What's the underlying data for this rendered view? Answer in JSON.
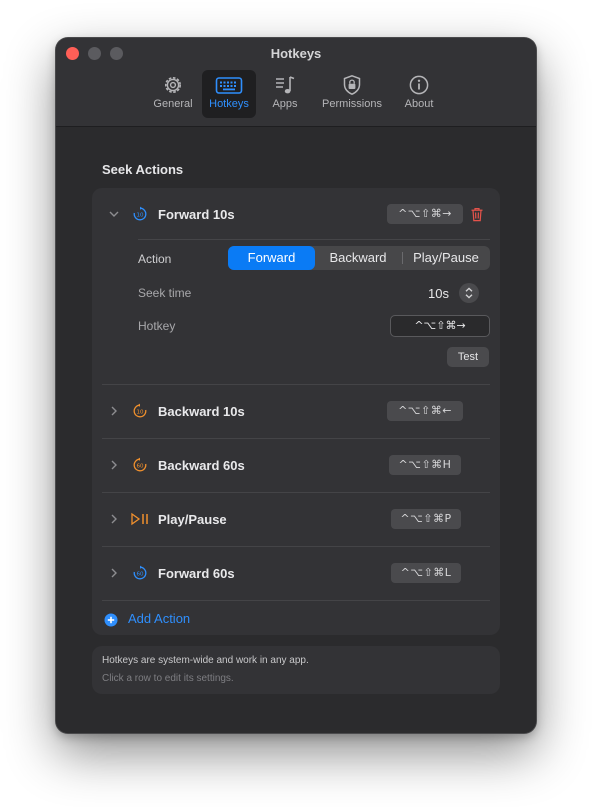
{
  "window": {
    "title": "Hotkeys"
  },
  "toolbar": {
    "items": [
      {
        "label": "General",
        "icon": "gear-icon"
      },
      {
        "label": "Hotkeys",
        "icon": "keyboard-icon",
        "active": true
      },
      {
        "label": "Apps",
        "icon": "music-note-list-icon"
      },
      {
        "label": "Permissions",
        "icon": "lock-shield-icon"
      },
      {
        "label": "About",
        "icon": "info-icon"
      }
    ]
  },
  "section": {
    "title": "Seek Actions"
  },
  "actions": [
    {
      "name": "Forward 10s",
      "shortcut": "^⌥⇧⌘→",
      "icon": "seek-forward-10-icon",
      "icon_color": "#2f8ffd",
      "expanded": true
    },
    {
      "name": "Backward 10s",
      "shortcut": "^⌥⇧⌘←",
      "icon": "seek-backward-10-icon",
      "icon_color": "#f0902d"
    },
    {
      "name": "Backward 60s",
      "shortcut": "^⌥⇧⌘H",
      "icon": "seek-backward-60-icon",
      "icon_color": "#f0902d"
    },
    {
      "name": "Play/Pause",
      "shortcut": "^⌥⇧⌘P",
      "icon": "play-pause-icon",
      "icon_color": "#f0902d"
    },
    {
      "name": "Forward 60s",
      "shortcut": "^⌥⇧⌘L",
      "icon": "seek-forward-60-icon",
      "icon_color": "#2f8ffd"
    }
  ],
  "editor": {
    "action_label": "Action",
    "action_options": [
      "Forward",
      "Backward",
      "Play/Pause"
    ],
    "action_selected": "Forward",
    "seek_label": "Seek time",
    "seek_value": "10s",
    "hotkey_label": "Hotkey",
    "hotkey_value": "^⌥⇧⌘→",
    "test_label": "Test"
  },
  "add_action": {
    "label": "Add Action"
  },
  "info": {
    "line1": "Hotkeys are system-wide and work in any app.",
    "line2": "Click a row to edit its settings."
  },
  "colors": {
    "accent": "#2f8ffd",
    "segment_selected": "#0a7bf5",
    "destructive": "#e5534b",
    "close": "#ff5f57"
  }
}
